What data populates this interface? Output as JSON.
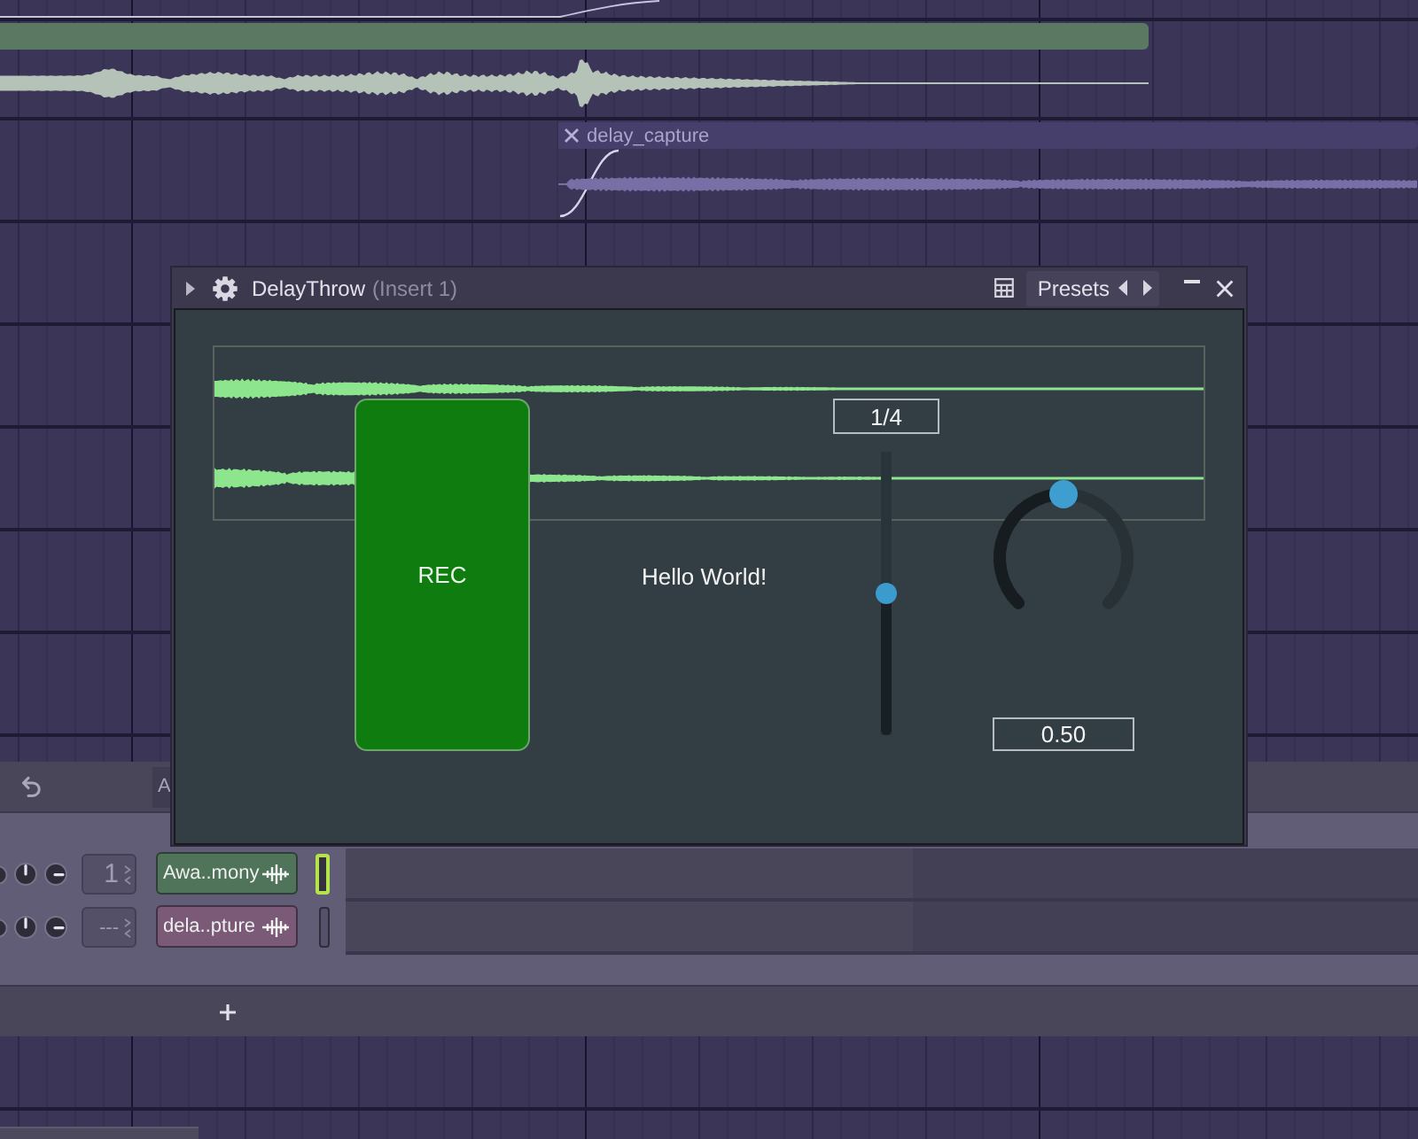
{
  "playlist": {
    "clips": [
      {
        "color": "#5a7862"
      },
      {
        "title": "delay_capture",
        "color": "#463f6b"
      }
    ]
  },
  "plugin_window": {
    "title": "DelayThrow",
    "subtitle": "(Insert 1)",
    "presets_label": "Presets",
    "rec_button": "REC",
    "text": "Hello World!",
    "slider": {
      "reading": "1/4",
      "level": 0.5
    },
    "knob": {
      "level": 0.5,
      "reading": "0.50"
    }
  },
  "channel_rack": {
    "toolbar_button": "A",
    "channels": [
      {
        "mixer_track": "1",
        "name": "Awa..mony",
        "color": "#4f7459",
        "selected": true
      },
      {
        "mixer_track": "---",
        "name": "dela..pture",
        "color": "#7a5a77",
        "selected": false
      }
    ]
  }
}
